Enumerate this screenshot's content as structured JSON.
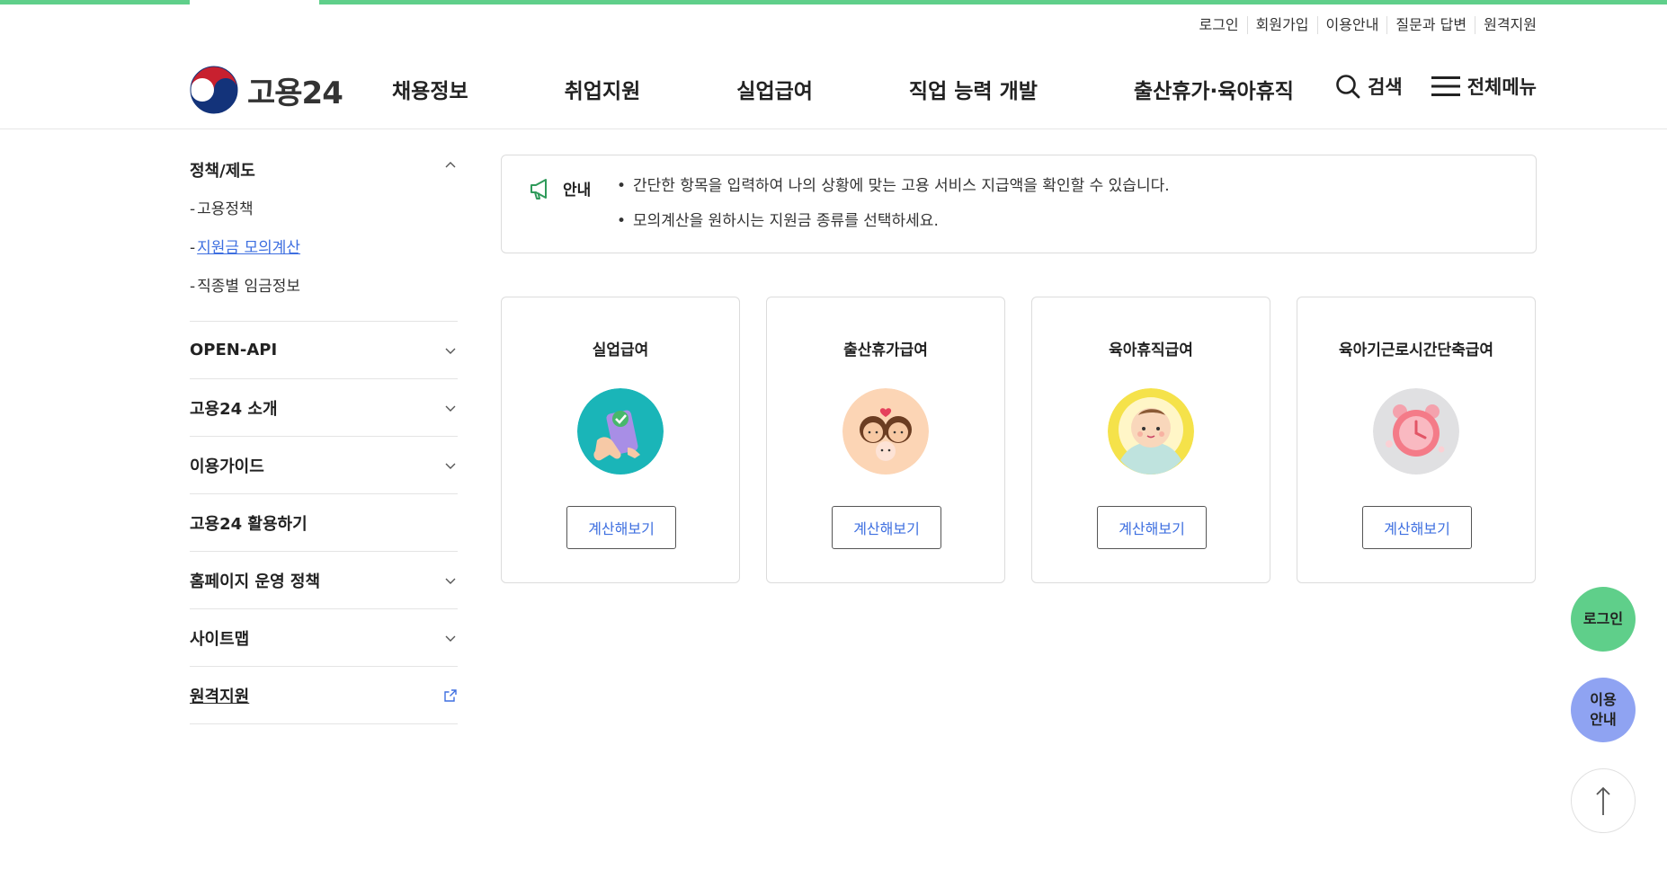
{
  "colors": {
    "accent": "#5fcf8a",
    "link": "#3e6fe0",
    "guide_fab": "#8fa3f2"
  },
  "util_links": [
    "로그인",
    "회원가입",
    "이용안내",
    "질문과 답변",
    "원격지원"
  ],
  "logo": {
    "text": "고용24"
  },
  "gnb": [
    "채용정보",
    "취업지원",
    "실업급여",
    "직업 능력 개발",
    "출산휴가·육아휴직"
  ],
  "header_actions": {
    "search": "검색",
    "menu": "전체메뉴"
  },
  "sidebar": {
    "groups": [
      {
        "label": "정책/제도",
        "expanded": true,
        "icon": "chevron-up-icon",
        "sub": [
          {
            "label": "고용정책",
            "active": false
          },
          {
            "label": "지원금 모의계산",
            "active": true
          },
          {
            "label": "직종별 임금정보",
            "active": false
          }
        ]
      },
      {
        "label": "OPEN-API",
        "icon": "chevron-down-icon"
      },
      {
        "label": "고용24 소개",
        "icon": "chevron-down-icon"
      },
      {
        "label": "이용가이드",
        "icon": "chevron-down-icon"
      },
      {
        "label": "고용24 활용하기",
        "icon": ""
      },
      {
        "label": "홈페이지 운영 정책",
        "icon": "chevron-down-icon"
      },
      {
        "label": "사이트맵",
        "icon": "chevron-down-icon"
      },
      {
        "label": "원격지원",
        "icon": "external-link-icon"
      }
    ]
  },
  "notice": {
    "label": "안내",
    "items": [
      "간단한 항목을 입력하여 나의 상황에 맞는 고용 서비스 지급액을 확인할 수 있습니다.",
      "모의계산을 원하시는 지원금 종류를 선택하세요."
    ]
  },
  "cards": [
    {
      "title": "실업급여",
      "icon": "phone-check-icon",
      "button": "계산해보기"
    },
    {
      "title": "출산휴가급여",
      "icon": "family-icon",
      "button": "계산해보기"
    },
    {
      "title": "육아휴직급여",
      "icon": "baby-icon",
      "button": "계산해보기"
    },
    {
      "title": "육아기근로시간단축급여",
      "icon": "alarm-clock-icon",
      "button": "계산해보기"
    }
  ],
  "floating": {
    "login": "로그인",
    "guide_line1": "이용",
    "guide_line2": "안내"
  }
}
